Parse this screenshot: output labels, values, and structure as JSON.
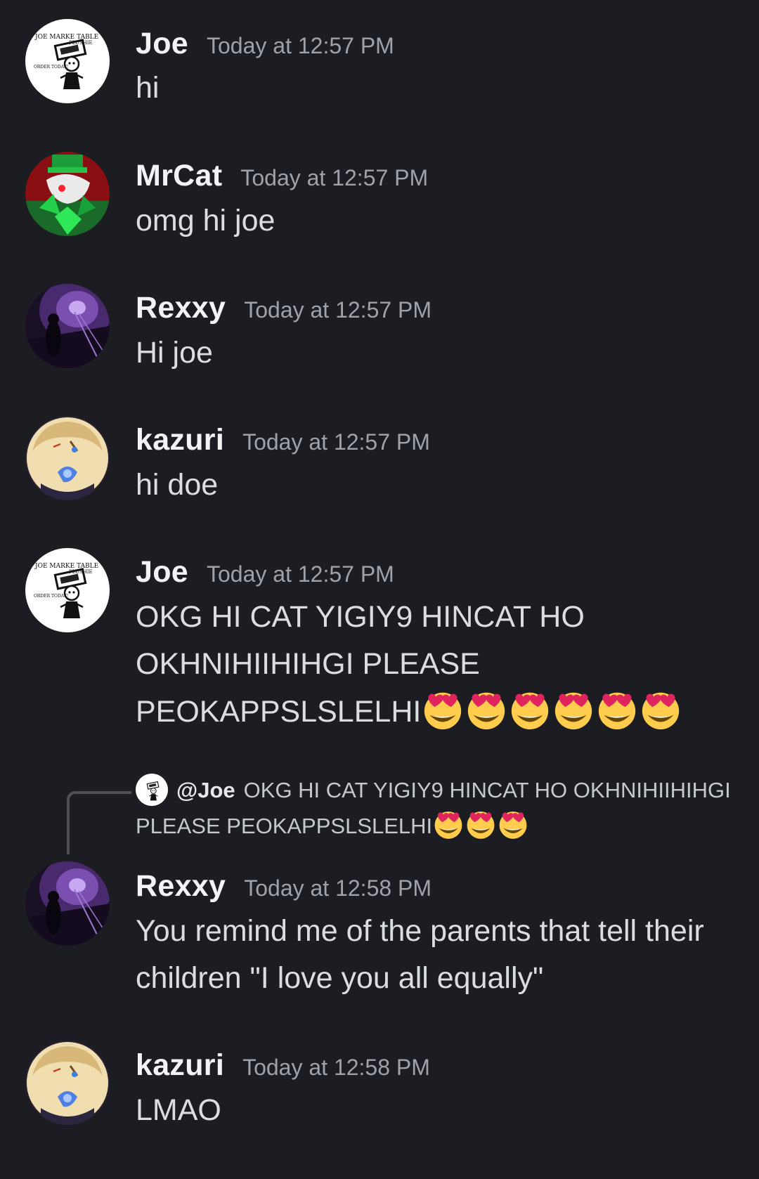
{
  "messages": [
    {
      "user": "Joe",
      "time": "Today at 12:57 PM",
      "text": "hi",
      "avatar": "joe-avatar"
    },
    {
      "user": "MrCat",
      "time": "Today at 12:57 PM",
      "text": "omg hi joe",
      "avatar": "mrcat-avatar"
    },
    {
      "user": "Rexxy",
      "time": "Today at 12:57 PM",
      "text": "Hi joe",
      "avatar": "rexxy-avatar"
    },
    {
      "user": "kazuri",
      "time": "Today at 12:57 PM",
      "text": "hi doe",
      "avatar": "kazuri-avatar"
    },
    {
      "user": "Joe",
      "time": "Today at 12:57 PM",
      "text": "OKG HI CAT YIGIY9 HINCAT HO OKHNIHIIHIHGI PLEASE PEOKAPPSLSLELHI",
      "emoji": "heart-eyes-emoji",
      "emoji_count": 6,
      "avatar": "joe-avatar"
    },
    {
      "user": "Rexxy",
      "time": "Today at 12:58 PM",
      "text": "You remind me of the parents that tell their children \"I love you all equally\"",
      "avatar": "rexxy-avatar"
    },
    {
      "user": "kazuri",
      "time": "Today at 12:58 PM",
      "text": "LMAO",
      "avatar": "kazuri-avatar"
    }
  ],
  "reply": {
    "author": "@Joe",
    "text": "OKG HI CAT YIGIY9 HINCAT HO OKHNIHIIHIHGI PLEASE PEOKAPPSLSLELHI",
    "emoji": "heart-eyes-emoji",
    "emoji_count": 3
  },
  "avatar_logo_text": {
    "line1": "JOE MARKE TABLE",
    "line2": "PLUSHIE",
    "line3": "ORDER TODAY!"
  },
  "colors": {
    "background": "#1c1d23",
    "username": "#f2f3f5",
    "timestamp": "#9ea2aa",
    "message_text": "#dbdee1",
    "reply_line": "#4e5058"
  }
}
